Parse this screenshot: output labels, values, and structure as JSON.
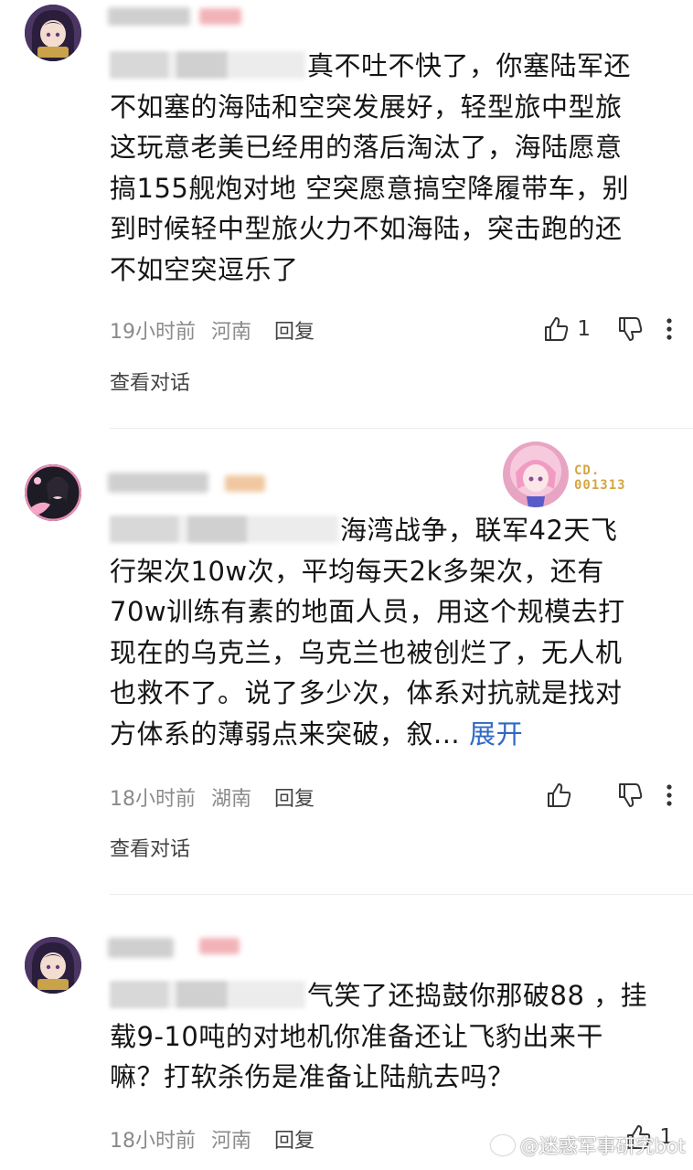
{
  "comments": [
    {
      "lines": [
        "真不吐不快了，你塞陆军还",
        "不如塞的海陆和空突发展好，轻型旅中型旅",
        "这玩意老美已经用的落后淘汰了，海陆愿意",
        "搞155舰炮对地 空突愿意搞空降履带车，别",
        "到时候轻中型旅火力不如海陆，突击跑的还",
        "不如空突逗乐了"
      ],
      "time": "19小时前",
      "location": "河南",
      "reply_label": "回复",
      "like_count": "1",
      "view_conversation": "查看对话"
    },
    {
      "lines": [
        "海湾战争，联军42天飞",
        "行架次10w次，平均每天2k多架次，还有",
        "70w训练有素的地面人员，用这个规模去打",
        "现在的乌克兰，乌克兰也被创烂了，无人机",
        "也救不了。说了多少次，体系对抗就是找对",
        "方体系的薄弱点来突破，叙..."
      ],
      "expand_label": "展开",
      "decoration_label": "CD.\n001313",
      "time": "18小时前",
      "location": "湖南",
      "reply_label": "回复",
      "like_count": "",
      "view_conversation": "查看对话"
    },
    {
      "lines": [
        "气笑了还捣鼓你那破88 ，挂",
        "载9-10吨的对地机你准备还让飞豹出来干",
        "嘛？打软杀伤是准备让陆航去吗？"
      ],
      "time": "18小时前",
      "location": "河南",
      "reply_label": "回复",
      "like_count": "1"
    }
  ],
  "watermark": "@迷惑军事研究bot",
  "icons": [
    "like-icon",
    "dislike-icon",
    "more-icon",
    "weibo-icon"
  ],
  "colors": {
    "link": "#2f68c4",
    "meta": "#8a8a8a",
    "text": "#151515"
  }
}
